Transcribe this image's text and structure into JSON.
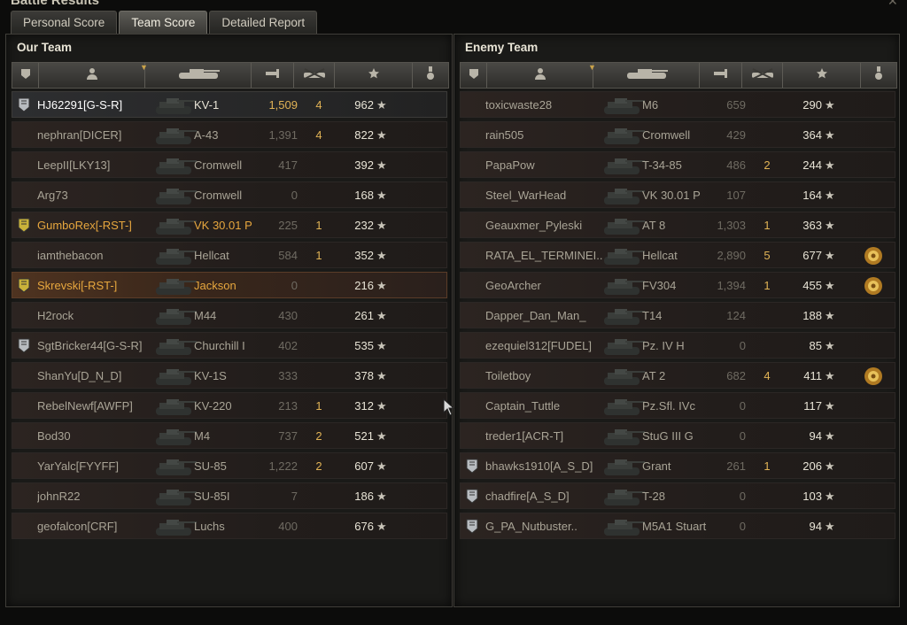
{
  "window": {
    "title": "Battle Results"
  },
  "tabs": [
    {
      "label": "Personal Score",
      "active": false
    },
    {
      "label": "Team Score",
      "active": true
    },
    {
      "label": "Detailed Report",
      "active": false
    }
  ],
  "columns": [
    {
      "key": "platoon",
      "icon": "platoon-icon"
    },
    {
      "key": "player",
      "icon": "player-icon"
    },
    {
      "key": "vehicle",
      "icon": "tank-icon",
      "sorted": true
    },
    {
      "key": "damage",
      "icon": "damage-icon"
    },
    {
      "key": "kills",
      "icon": "destroyed-tank-icon"
    },
    {
      "key": "xp",
      "icon": "star-icon"
    },
    {
      "key": "medals",
      "icon": "medal-icon"
    }
  ],
  "colors": {
    "accent_gold": "#e0b255",
    "orange_player": "#e7a73e",
    "text": "#a9a496"
  },
  "our_team": {
    "title": "Our Team",
    "rows": [
      {
        "player": "HJ62291[G-S-R]",
        "vehicle": "KV-1",
        "damage": "1,509",
        "kills": "4",
        "xp": "962",
        "badge": "silver",
        "me": true
      },
      {
        "player": "nephran[DICER]",
        "vehicle": "A-43",
        "damage": "1,391",
        "kills": "4",
        "xp": "822"
      },
      {
        "player": "LeepII[LKY13]",
        "vehicle": "Cromwell",
        "damage": "417",
        "kills": "",
        "xp": "392"
      },
      {
        "player": "Arg73",
        "vehicle": "Cromwell",
        "damage": "0",
        "kills": "",
        "xp": "168"
      },
      {
        "player": "GumboRex[-RST-]",
        "vehicle": "VK 30.01 P",
        "damage": "225",
        "kills": "1",
        "xp": "232",
        "badge": "gold",
        "orange": true
      },
      {
        "player": "iamthebacon",
        "vehicle": "Hellcat",
        "damage": "584",
        "kills": "1",
        "xp": "352"
      },
      {
        "player": "Skrevski[-RST-]",
        "vehicle": "Jackson",
        "damage": "0",
        "kills": "",
        "xp": "216",
        "badge": "gold",
        "orange": true,
        "highlight": true
      },
      {
        "player": "H2rock",
        "vehicle": "M44",
        "damage": "430",
        "kills": "",
        "xp": "261"
      },
      {
        "player": "SgtBricker44[G-S-R]",
        "vehicle": "Churchill I",
        "damage": "402",
        "kills": "",
        "xp": "535",
        "badge": "silver"
      },
      {
        "player": "ShanYu[D_N_D]",
        "vehicle": "KV-1S",
        "damage": "333",
        "kills": "",
        "xp": "378"
      },
      {
        "player": "RebelNewf[AWFP]",
        "vehicle": "KV-220",
        "damage": "213",
        "kills": "1",
        "xp": "312"
      },
      {
        "player": "Bod30",
        "vehicle": "M4",
        "damage": "737",
        "kills": "2",
        "xp": "521"
      },
      {
        "player": "YarYalc[FYYFF]",
        "vehicle": "SU-85",
        "damage": "1,222",
        "kills": "2",
        "xp": "607"
      },
      {
        "player": "johnR22",
        "vehicle": "SU-85I",
        "damage": "7",
        "kills": "",
        "xp": "186"
      },
      {
        "player": "geofalcon[CRF]",
        "vehicle": "Luchs",
        "damage": "400",
        "kills": "",
        "xp": "676"
      }
    ]
  },
  "enemy_team": {
    "title": "Enemy Team",
    "rows": [
      {
        "player": "toxicwaste28",
        "vehicle": "M6",
        "damage": "659",
        "kills": "",
        "xp": "290"
      },
      {
        "player": "rain505",
        "vehicle": "Cromwell",
        "damage": "429",
        "kills": "",
        "xp": "364"
      },
      {
        "player": "PapaPow",
        "vehicle": "T-34-85",
        "damage": "486",
        "kills": "2",
        "xp": "244"
      },
      {
        "player": "Steel_WarHead",
        "vehicle": "VK 30.01 P",
        "damage": "107",
        "kills": "",
        "xp": "164"
      },
      {
        "player": "Geauxmer_Pyleski",
        "vehicle": "AT 8",
        "damage": "1,303",
        "kills": "1",
        "xp": "363"
      },
      {
        "player": "RATA_EL_TERMINEI..",
        "vehicle": "Hellcat",
        "damage": "2,890",
        "kills": "5",
        "xp": "677",
        "medal": true
      },
      {
        "player": "GeoArcher",
        "vehicle": "FV304",
        "damage": "1,394",
        "kills": "1",
        "xp": "455",
        "medal": true
      },
      {
        "player": "Dapper_Dan_Man_",
        "vehicle": "T14",
        "damage": "124",
        "kills": "",
        "xp": "188"
      },
      {
        "player": "ezequiel312[FUDEL]",
        "vehicle": "Pz. IV H",
        "damage": "0",
        "kills": "",
        "xp": "85"
      },
      {
        "player": "Toiletboy",
        "vehicle": "AT 2",
        "damage": "682",
        "kills": "4",
        "xp": "411",
        "medal": true
      },
      {
        "player": "Captain_Tuttle",
        "vehicle": "Pz.Sfl. IVc",
        "damage": "0",
        "kills": "",
        "xp": "117"
      },
      {
        "player": "treder1[ACR-T]",
        "vehicle": "StuG III G",
        "damage": "0",
        "kills": "",
        "xp": "94"
      },
      {
        "player": "bhawks1910[A_S_D]",
        "vehicle": "Grant",
        "damage": "261",
        "kills": "1",
        "xp": "206",
        "badge": "silver"
      },
      {
        "player": "chadfire[A_S_D]",
        "vehicle": "T-28",
        "damage": "0",
        "kills": "",
        "xp": "103",
        "badge": "silver"
      },
      {
        "player": "G_PA_Nutbuster..",
        "vehicle": "M5A1 Stuart",
        "damage": "0",
        "kills": "",
        "xp": "94",
        "badge": "silver"
      }
    ]
  }
}
